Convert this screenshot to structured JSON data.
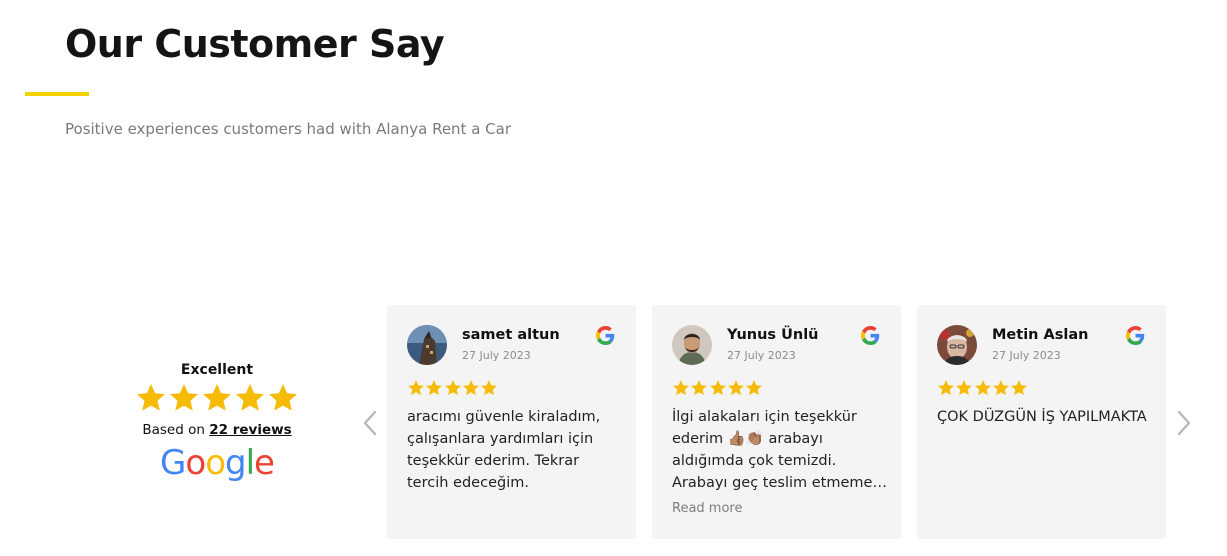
{
  "section": {
    "title": "Our Customer Say",
    "subtitle": "Positive experiences customers had with Alanya Rent a Car",
    "accent_color": "#f2d300"
  },
  "summary": {
    "rating_label": "Excellent",
    "stars": 5,
    "based_on_prefix": "Based on",
    "reviews_link": "22 reviews",
    "provider_logo": {
      "letters": [
        "G",
        "o",
        "o",
        "g",
        "l",
        "e"
      ],
      "colors": [
        "#4285F4",
        "#EA4335",
        "#FBBC05",
        "#4285F4",
        "#34A853",
        "#EA4335"
      ]
    },
    "star_color": "#f6bb06"
  },
  "carousel": {
    "prev_icon": "chevron-left-icon",
    "next_icon": "chevron-right-icon",
    "reviews": [
      {
        "name": "samet altun",
        "date": "27 July 2023",
        "rating": 5,
        "text": "aracımı güvenle kiraladım, çalışanlara yardımları için teşekkür ederim. Tekrar tercih edeceğim.",
        "source_icon": "google-icon"
      },
      {
        "name": "Yunus Ünlü",
        "date": "27 July 2023",
        "rating": 5,
        "text": "İlgi alakaları için teşekkür ederim 👍🏽👏🏽 arabayı aldığımda çok temizdi. Arabayı geç teslim etmeme rağmen anlayışlı davrandılar.",
        "read_more": "Read more",
        "source_icon": "google-icon"
      },
      {
        "name": "Metin Aslan",
        "date": "27 July 2023",
        "rating": 5,
        "text": "ÇOK DÜZGÜN İŞ YAPILMAKTA",
        "source_icon": "google-icon"
      }
    ]
  }
}
